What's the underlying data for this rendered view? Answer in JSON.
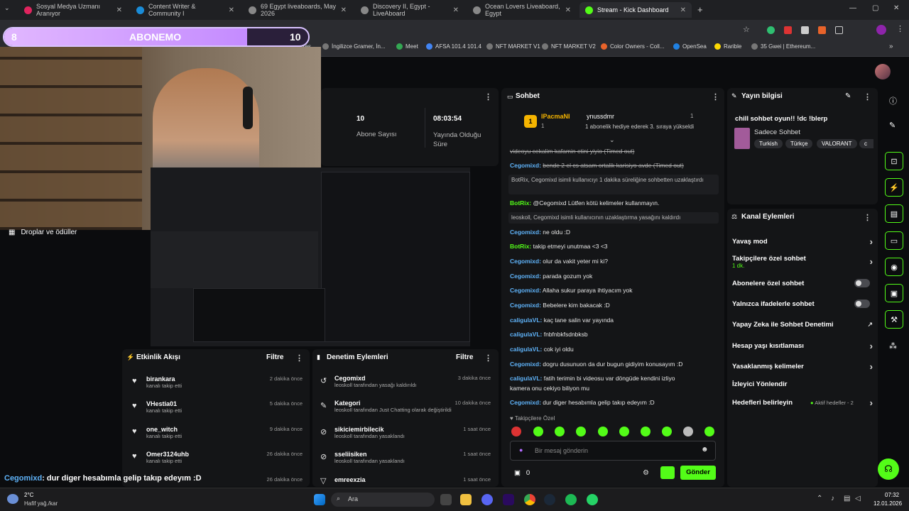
{
  "browser": {
    "tabs": [
      {
        "label": "Sosyal Medya Uzmanı Aranıyor",
        "color": "#e0245e"
      },
      {
        "label": "Content Writer & Community I",
        "color": "#1a8cd8"
      },
      {
        "label": "69 Egypt liveaboards, May 2026",
        "color": "#888888"
      },
      {
        "label": "Discovery II, Egypt - LiveAboard",
        "color": "#888888"
      },
      {
        "label": "Ocean Lovers Liveaboard, Egypt",
        "color": "#888888"
      },
      {
        "label": "Stream - Kick Dashboard",
        "color": "#53fc18"
      }
    ],
    "new_tab": "+",
    "bookmarks": [
      "asses",
      "İngilizce Gramer, İn...",
      "Meet",
      "AFSA 101.4 101.4",
      "NFT MARKET V1",
      "NFT MARKET V2",
      "Color Owners - Coll...",
      "OpenSea",
      "Rarible",
      "35 Gwei | Ethereum..."
    ]
  },
  "overlay": {
    "left_count": "8",
    "title": "ABONEMO",
    "right_count": "10"
  },
  "drops_label": "Droplar ve ödüller",
  "stats": {
    "subs_value": "10",
    "subs_label": "Abone Sayısı",
    "live_value": "08:03:54",
    "live_label": "Yayında Olduğu Süre"
  },
  "chat": {
    "title": "Sohbet",
    "pinned": {
      "rank": "1",
      "user1": "IPacmaNI",
      "user1_sub": "1",
      "user2": "ynussdmr",
      "user2_count": "1",
      "gift_text": "1 abonelik hediye ederek 3. sıraya yükseldi"
    },
    "messages": [
      {
        "user": "",
        "text": "videoyu cekalim kafamin etini yiyio (Timed out)"
      },
      {
        "user": "Cegomixd:",
        "text": "bende 2 el cs atsam ortalik karisiyo avde (Timed out)"
      },
      {
        "user": "BotRix:",
        "text": "@Cegomixd Lütfen kötü kelimeler kullanmayın."
      },
      {
        "user": "Cegomixd:",
        "text": "ne oldu :D"
      },
      {
        "user": "BotRix:",
        "text": "takip etmeyi unutmaa <3 <3"
      },
      {
        "user": "Cegomixd:",
        "text": "olur da vakit yeter mi ki?"
      },
      {
        "user": "Cegomixd:",
        "text": "parada gozum yok"
      },
      {
        "user": "Cegomixd:",
        "text": "Allaha sukur paraya ihtiyacım yok"
      },
      {
        "user": "Cegomixd:",
        "text": "Bebelere kim bakacak :D"
      },
      {
        "user": "caligulaVL:",
        "text": "kaç tane salin var yayında"
      },
      {
        "user": "caligulaVL:",
        "text": "fnbfnbkfsdnbksb"
      },
      {
        "user": "caligulaVL:",
        "text": "cok iyi oldu"
      },
      {
        "user": "Cegomixd:",
        "text": "dogru dusunuon da dur bugun gidiyim konusayım :D"
      },
      {
        "user": "caligulaVL:",
        "text": "fatih terimin bi videosu var döngüde kendini izliyo"
      },
      {
        "user": "",
        "text": "kamera onu cekiyo biliyon mu"
      },
      {
        "user": "Cegomixd:",
        "text": "dur diger hesabımla gelip takıp edeyım :D"
      }
    ],
    "sys1": "BotRix, Cegomixd isimli kullanıcıyı 1 dakika süreliğine sohbetten uzaklaştırdı",
    "sys2": "leoskoll, Cegomixd isimli kullanıcının uzaklaştırma yasağını kaldırdı",
    "followers_only": "Takipçilere Özel",
    "input_placeholder": "Bir mesaj gönderin",
    "points": "0",
    "send": "Gönder"
  },
  "stream_info": {
    "title": "Yayın bilgisi",
    "stream_title": "chill sohbet oyun!! !dc !blerp",
    "category": "Sadece Sohbet",
    "tags": [
      "Turkish",
      "Türkçe",
      "VALORANT",
      "c"
    ]
  },
  "channel_actions": {
    "title": "Kanal Eylemleri",
    "rows": [
      {
        "label": "Yavaş mod",
        "sub": ""
      },
      {
        "label": "Takipçilere özel sohbet",
        "sub": "1 dk."
      },
      {
        "label": "Abonelere özel sohbet",
        "sub": ""
      },
      {
        "label": "Yalnızca ifadelerle sohbet",
        "sub": ""
      },
      {
        "label": "Yapay Zeka ile Sohbet Denetimi",
        "sub": ""
      },
      {
        "label": "Hesap yaşı kısıtlaması",
        "sub": ""
      },
      {
        "label": "Yasaklanmış kelimeler",
        "sub": ""
      },
      {
        "label": "İzleyici Yönlendir",
        "sub": ""
      },
      {
        "label": "Hedefleri belirleyin",
        "sub": "Aktif hedefler - 2"
      }
    ]
  },
  "activity": {
    "title": "Etkinlik Akışı",
    "filter": "Filtre",
    "items": [
      {
        "name": "birankara",
        "sub": "kanalı takip etti",
        "time": "2 dakika önce"
      },
      {
        "name": "VHestia01",
        "sub": "kanalı takip etti",
        "time": "5 dakika önce"
      },
      {
        "name": "one_witch",
        "sub": "kanalı takip etti",
        "time": "9 dakika önce"
      },
      {
        "name": "Omer3124uhb",
        "sub": "kanalı takip etti",
        "time": "26 dakika önce"
      },
      {
        "name": "",
        "sub": "",
        "time": "26 dakika önce"
      }
    ]
  },
  "moderation": {
    "title": "Denetim Eylemleri",
    "filter": "Filtre",
    "items": [
      {
        "name": "Cegomixd",
        "sub": "leoskoll tarafından yasağı kaldırıldı",
        "time": "3 dakika önce"
      },
      {
        "name": "Kategori",
        "sub": "leoskoll tarafından Just Chatting olarak değiştirildi",
        "time": "10 dakika önce"
      },
      {
        "name": "sikiciemirbilecik",
        "sub": "leoskoll tarafından yasaklandı",
        "time": "1 saat önce"
      },
      {
        "name": "sseliisiken",
        "sub": "leoskoll tarafından yasaklandı",
        "time": "1 saat önce"
      },
      {
        "name": "emreexzia",
        "sub": "",
        "time": "1 saat önce"
      }
    ]
  },
  "overlay_chat": {
    "user": "Cegomixd",
    "text": ": dur diger hesabımla gelip takıp edeyım :D"
  },
  "taskbar": {
    "weather_temp": "2°C",
    "weather_desc": "Hafif yağ./kar",
    "search": "Ara",
    "time": "07:32",
    "date": "12.01.2026"
  }
}
